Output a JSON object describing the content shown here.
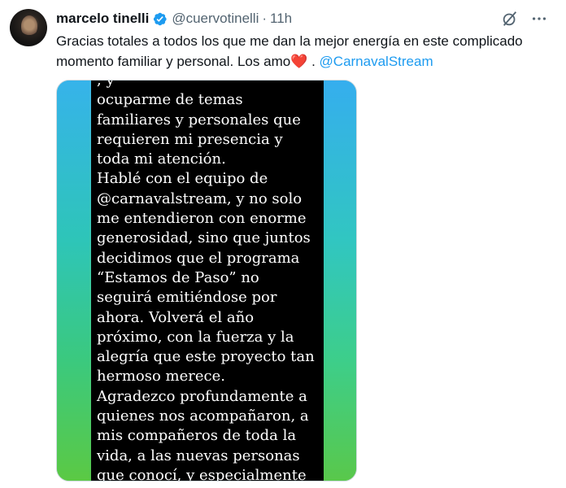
{
  "tweet": {
    "author_name": "marcelo tinelli",
    "handle": "@cuervotinelli",
    "separator": "·",
    "time": "11h",
    "text_main": "Gracias totales a todos los que me dan la mejor energía en este complicado momento familiar y personal. Los amo",
    "heart": "❤️",
    "text_sep": " . ",
    "mention": "@CarnavalStream"
  },
  "media": {
    "story_text": ", y\nocuparme de temas\nfamiliares y personales que\nrequieren mi presencia y\ntoda mi atención.\nHablé con el equipo de\n@carnavalstream, y no solo\nme entendieron con enorme\ngenerosidad, sino que juntos\ndecidimos que el programa\n“Estamos de Paso” no\nseguirá emitiéndose por\nahora. Volverá el año\npróximo, con la fuerza y la\nalegría que este proyecto tan\nhermoso merece.\nAgradezco profundamente a\nquienes nos acompañaron, a\nmis compañeros de toda la\nvida, a las nuevas personas\nque conocí, y especialmente"
  },
  "icons": {
    "verified": "verified-badge-icon",
    "grok": "grok-icon",
    "more": "more-icon"
  },
  "colors": {
    "accent": "#1d9bf0",
    "secondary_text": "#536471",
    "heart": "#e0245e"
  }
}
